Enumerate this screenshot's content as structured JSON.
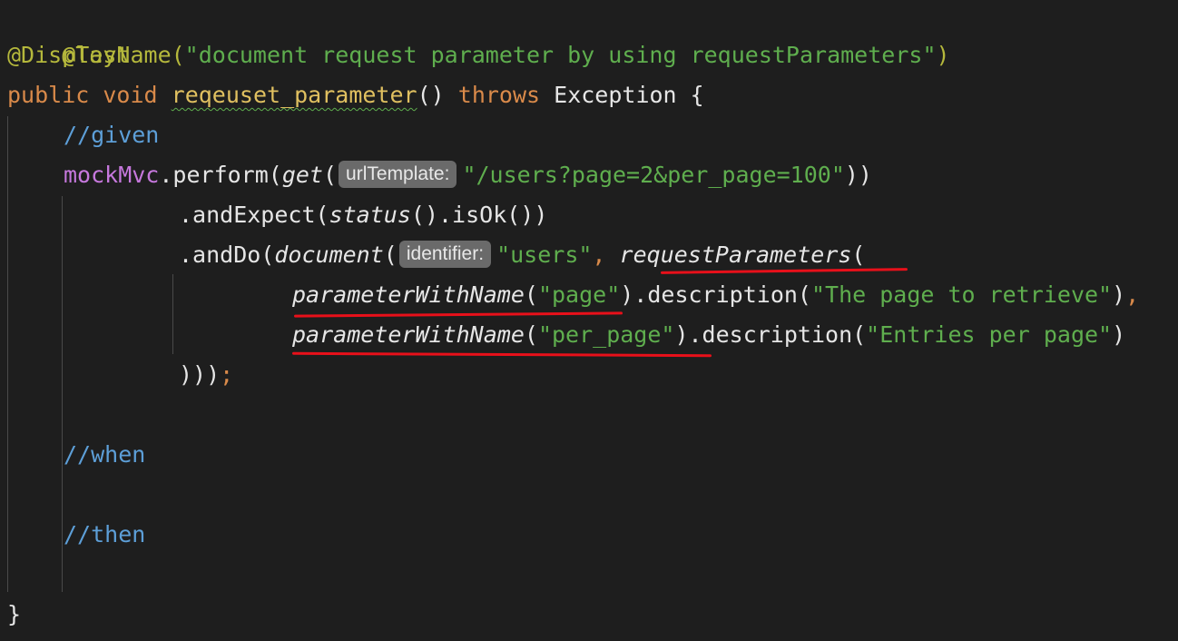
{
  "code": {
    "l1": {
      "annotation": "@Test"
    },
    "l2": {
      "annotation": "@DisplayName(",
      "string": "\"document request parameter by using requestParameters\"",
      "close": ")"
    },
    "l3": {
      "kw_public": "public",
      "kw_void": "void",
      "method": "reqeuset_parameter",
      "parens": "()",
      "kw_throws": "throws",
      "exception": "Exception {"
    },
    "l4": {
      "comment": "//given"
    },
    "l5": {
      "field": "mockMvc",
      "perform": ".perform(",
      "get": "get",
      "open": "(",
      "hint": "urlTemplate:",
      "url": "\"/users?page=2&per_page=100\"",
      "close": "))"
    },
    "l6": {
      "andExpect": ".andExpect(",
      "status": "status",
      "rest": "().isOk())"
    },
    "l7": {
      "andDo": ".andDo(",
      "document": "document",
      "open": "(",
      "hint": "identifier:",
      "users": "\"users\"",
      "comma": ",",
      "reqParams": "requestParameters",
      "open2": "("
    },
    "l8": {
      "pwn": "parameterWithName",
      "open": "(",
      "arg": "\"page\"",
      "desc": ").description(",
      "text": "\"The page to retrieve\"",
      "close": ")",
      "comma": ","
    },
    "l9": {
      "pwn": "parameterWithName",
      "open": "(",
      "arg": "\"per_page\"",
      "desc": ").description(",
      "text": "\"Entries per page\"",
      "close": ")"
    },
    "l10": {
      "close": ")))",
      "semi": ";"
    },
    "l11": {
      "comment": "//when"
    },
    "l12": {
      "comment": "//then"
    },
    "l13": {
      "brace": "}"
    }
  },
  "colors": {
    "background": "#1e1e1e",
    "annotation": "#b5b83c",
    "keyword": "#d98a4a",
    "string": "#5fae4e",
    "comment": "#5d9fd8",
    "field": "#c678dd",
    "highlight_underline": "#e8101a"
  }
}
